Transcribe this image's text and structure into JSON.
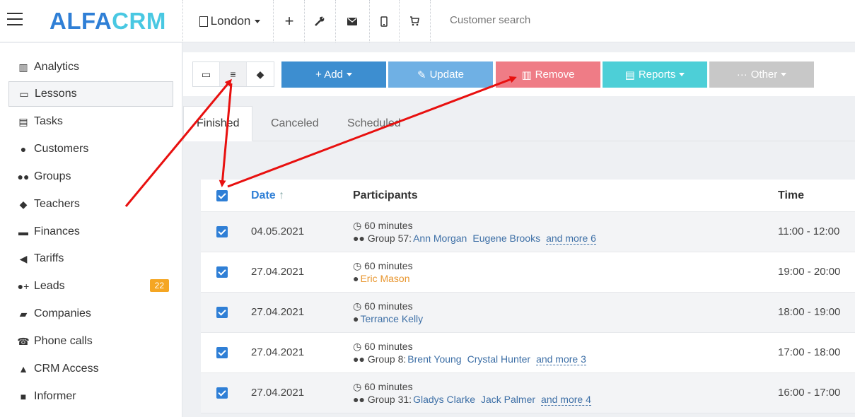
{
  "topbar": {
    "logo_alfa": "ALFA",
    "logo_crm": "CRM",
    "city": "London",
    "search_placeholder": "Customer search",
    "icons": [
      "building-icon",
      "plus-icon",
      "wrench-icon",
      "envelope-icon",
      "mobile-icon",
      "cart-icon"
    ]
  },
  "sidebar": {
    "items": [
      {
        "label": "Analytics",
        "icon": "map-icon"
      },
      {
        "label": "Lessons",
        "icon": "calendar-icon"
      },
      {
        "label": "Tasks",
        "icon": "clipboard-icon"
      },
      {
        "label": "Customers",
        "icon": "user-icon"
      },
      {
        "label": "Groups",
        "icon": "users-icon"
      },
      {
        "label": "Teachers",
        "icon": "graduation-cap-icon"
      },
      {
        "label": "Finances",
        "icon": "money-icon"
      },
      {
        "label": "Tariffs",
        "icon": "tag-icon"
      },
      {
        "label": "Leads",
        "icon": "user-plus-icon",
        "badge": "22"
      },
      {
        "label": "Companies",
        "icon": "briefcase-icon"
      },
      {
        "label": "Phone calls",
        "icon": "phone-icon"
      },
      {
        "label": "CRM Access",
        "icon": "lock-icon"
      },
      {
        "label": "Informer",
        "icon": "book-icon"
      }
    ]
  },
  "toolbar": {
    "view_icons": [
      "calendar-view-icon",
      "list-view-icon",
      "layers-view-icon"
    ],
    "add_label": "+ Add",
    "update_label": "Update",
    "remove_label": "Remove",
    "reports_label": "Reports",
    "other_label": "Other",
    "colors": {
      "add": "#3d8ed0",
      "update": "#6fb0e4",
      "remove": "#ef7c86",
      "reports": "#4dcfd7",
      "other": "#c8c8c8"
    }
  },
  "tabs": [
    "Finished",
    "Canceled",
    "Scheduled"
  ],
  "table": {
    "headers": {
      "date": "Date",
      "date_sort": "↑",
      "participants": "Participants",
      "time": "Time"
    },
    "rows": [
      {
        "date": "04.05.2021",
        "duration": "60 minutes",
        "group": "Group 57:",
        "people": [
          "Ann Morgan",
          "Eugene Brooks"
        ],
        "more": "and more 6",
        "time": "11:00 - 12:00"
      },
      {
        "date": "27.04.2021",
        "duration": "60 minutes",
        "group": "",
        "people": [
          "Eric Mason"
        ],
        "more": "",
        "time": "19:00 - 20:00"
      },
      {
        "date": "27.04.2021",
        "duration": "60 minutes",
        "group": "",
        "people": [
          "Terrance Kelly"
        ],
        "more": "",
        "time": "18:00 - 19:00"
      },
      {
        "date": "27.04.2021",
        "duration": "60 minutes",
        "group": "Group 8:",
        "people": [
          "Brent Young",
          "Crystal Hunter"
        ],
        "more": "and more 3",
        "time": "17:00 - 18:00"
      },
      {
        "date": "27.04.2021",
        "duration": "60 minutes",
        "group": "Group 31:",
        "people": [
          "Gladys Clarke",
          "Jack Palmer"
        ],
        "more": "and more 4",
        "time": "16:00 - 17:00"
      }
    ]
  },
  "annotation_color": "#e8100f"
}
